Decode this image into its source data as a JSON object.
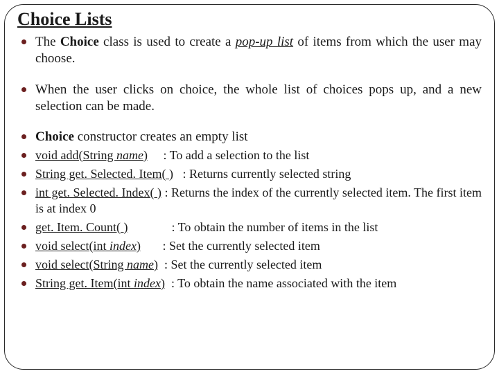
{
  "title": "Choice Lists",
  "bullets": {
    "b1_pre": "The ",
    "b1_bold": "Choice",
    "b1_mid": " class is used to create a ",
    "b1_ital": "pop-up list",
    "b1_post": " of items from which the user may choose.",
    "b2": "When the user clicks on choice, the whole list of choices pops up, and a new selection can be made.",
    "b3_bold": "Choice",
    "b3_post": " constructor creates an empty list"
  },
  "methods": {
    "m1_sig_pre": "void add(String ",
    "m1_sig_arg": "name",
    "m1_sig_post": ")",
    "m1_desc": "     : To add a selection to the list",
    "m2_sig": "String get. Selected. Item( )",
    "m2_desc": "   : Returns currently selected string",
    "m3_sig": "int get. Selected. Index( )",
    "m3_desc": "  : Returns the index of the currently selected item. The first item is at index 0",
    "m4_sig": "get. Item. Count( )",
    "m4_desc": "              : To obtain the number of items in the list",
    "m5_sig_pre": "void select(int ",
    "m5_sig_arg": "index",
    "m5_sig_post": ")",
    "m5_desc": "       : Set the currently selected item",
    "m6_sig_pre": "void select(String ",
    "m6_sig_arg": "name",
    "m6_sig_post": ")",
    "m6_desc": "  : Set the currently selected item",
    "m7_sig_pre": "String get. Item(int ",
    "m7_sig_arg": "index",
    "m7_sig_post": ")",
    "m7_desc": "  : To obtain the name associated with the item"
  }
}
